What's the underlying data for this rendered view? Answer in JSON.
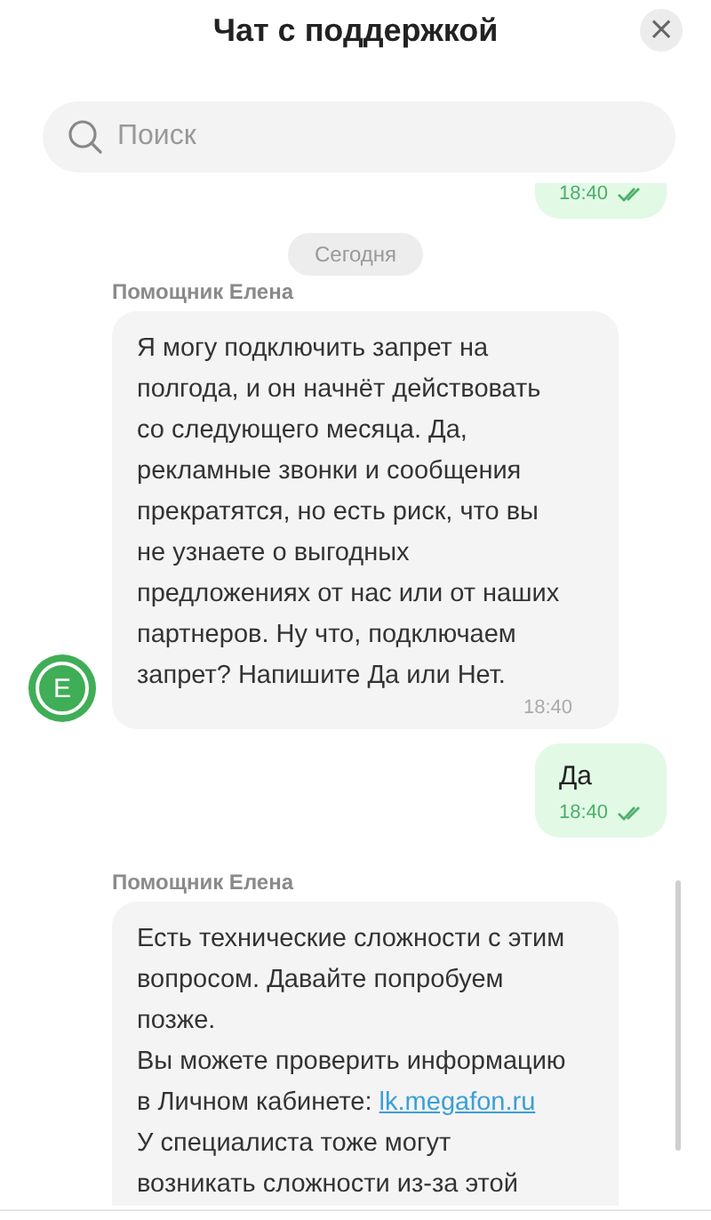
{
  "header": {
    "title": "Чат с поддержкой",
    "close": "×"
  },
  "search": {
    "placeholder": "Поиск"
  },
  "messages": [
    {
      "kind": "outgoing",
      "time": "18:40"
    },
    {
      "kind": "date",
      "text": "Сегодня"
    },
    {
      "kind": "incoming",
      "author": "Помощник Елена",
      "avatar": "Е",
      "paragraphs": [
        {
          "text": "Я могу подключить запрет на полгода, и он начнёт действовать со следующего месяца. Да, рекламные звонки и сообщения прекратятся, но есть риск, что вы не узнаете о выгодных предложениях от нас или от наших партнеров. Ну что, подключаем запрет? Напишите Да или Нет."
        }
      ],
      "time": "18:40"
    },
    {
      "kind": "outgoing",
      "text": "Да",
      "time": "18:40"
    },
    {
      "kind": "incoming",
      "author": "Помощник Елена",
      "paragraphs": [
        {
          "text": "Есть технические сложности с этим вопросом. Давайте попробуем позже."
        },
        {
          "text": "Вы можете проверить информацию в Личном кабинете:",
          "link": "lk.megafon.ru"
        },
        {
          "text": "У специалиста тоже могут возникать сложности из-за этой"
        }
      ]
    }
  ]
}
